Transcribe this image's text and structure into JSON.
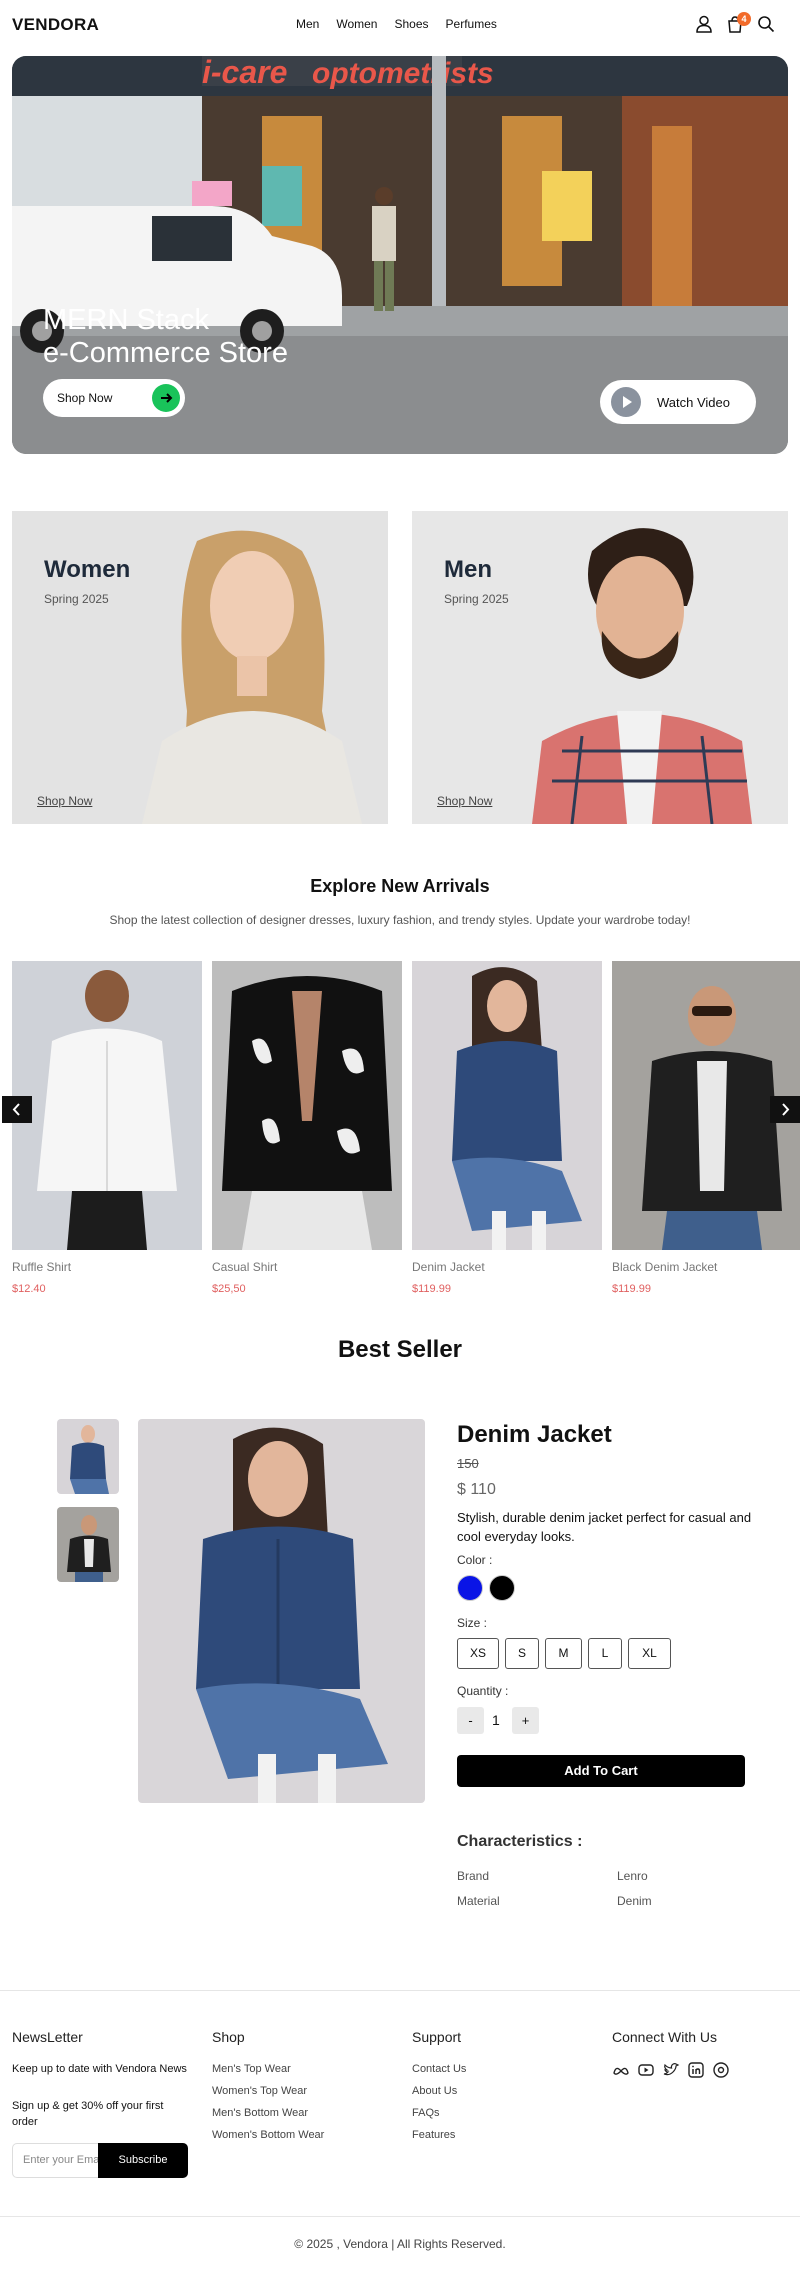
{
  "header": {
    "logo": "VENDORA",
    "nav": [
      "Men",
      "Women",
      "Shoes",
      "Perfumes"
    ],
    "cart_count": "4"
  },
  "hero": {
    "title_line1": "MERN Stack",
    "title_line2": "e-Commerce Store",
    "storefront_sign_left": "i-care",
    "storefront_sign_right": "optometrists",
    "shop_now": "Shop Now",
    "watch_video": "Watch Video"
  },
  "categories": [
    {
      "title": "Women",
      "subtitle": "Spring 2025",
      "link": "Shop Now"
    },
    {
      "title": "Men",
      "subtitle": "Spring 2025",
      "link": "Shop Now"
    }
  ],
  "arrivals": {
    "title": "Explore New Arrivals",
    "subtitle": "Shop the latest collection of designer dresses, luxury fashion, and trendy styles. Update your wardrobe today!",
    "products": [
      {
        "name": "Ruffle Shirt",
        "price": "$12.40"
      },
      {
        "name": "Casual Shirt",
        "price": "$25,50"
      },
      {
        "name": "Denim Jacket",
        "price": "$119.99"
      },
      {
        "name": "Black Denim Jacket",
        "price": "$119.99"
      }
    ]
  },
  "best_seller": {
    "title": "Best Seller",
    "name": "Denim Jacket",
    "old_price": "150",
    "price": "$ 110",
    "description": "Stylish, durable denim jacket perfect for casual and cool everyday looks.",
    "color_label": "Color :",
    "colors": [
      "#0a14e6",
      "#000000"
    ],
    "size_label": "Size :",
    "sizes": [
      "XS",
      "S",
      "M",
      "L",
      "XL"
    ],
    "quantity_label": "Quantity :",
    "quantity": "1",
    "minus": "-",
    "plus": "+",
    "add_to_cart": "Add To Cart",
    "characteristics_title": "Characteristics :",
    "characteristics": [
      {
        "key": "Brand",
        "value": "Lenro"
      },
      {
        "key": "Material",
        "value": "Denim"
      }
    ]
  },
  "footer": {
    "newsletter": {
      "title": "NewsLetter",
      "text1": "Keep up to date with Vendora News",
      "text2": "Sign up & get 30% off your first order",
      "placeholder": "Enter your Email",
      "button": "Subscribe"
    },
    "shop": {
      "title": "Shop",
      "links": [
        "Men's Top Wear",
        "Women's Top Wear",
        "Men's Bottom Wear",
        "Women's Bottom Wear"
      ]
    },
    "support": {
      "title": "Support",
      "links": [
        "Contact Us",
        "About Us",
        "FAQs",
        "Features"
      ]
    },
    "connect": {
      "title": "Connect With Us",
      "icons": [
        "meta-icon",
        "youtube-icon",
        "twitter-icon",
        "linkedin-icon",
        "threads-icon"
      ]
    },
    "copyright": "© 2025 , Vendora | All Rights Reserved."
  }
}
